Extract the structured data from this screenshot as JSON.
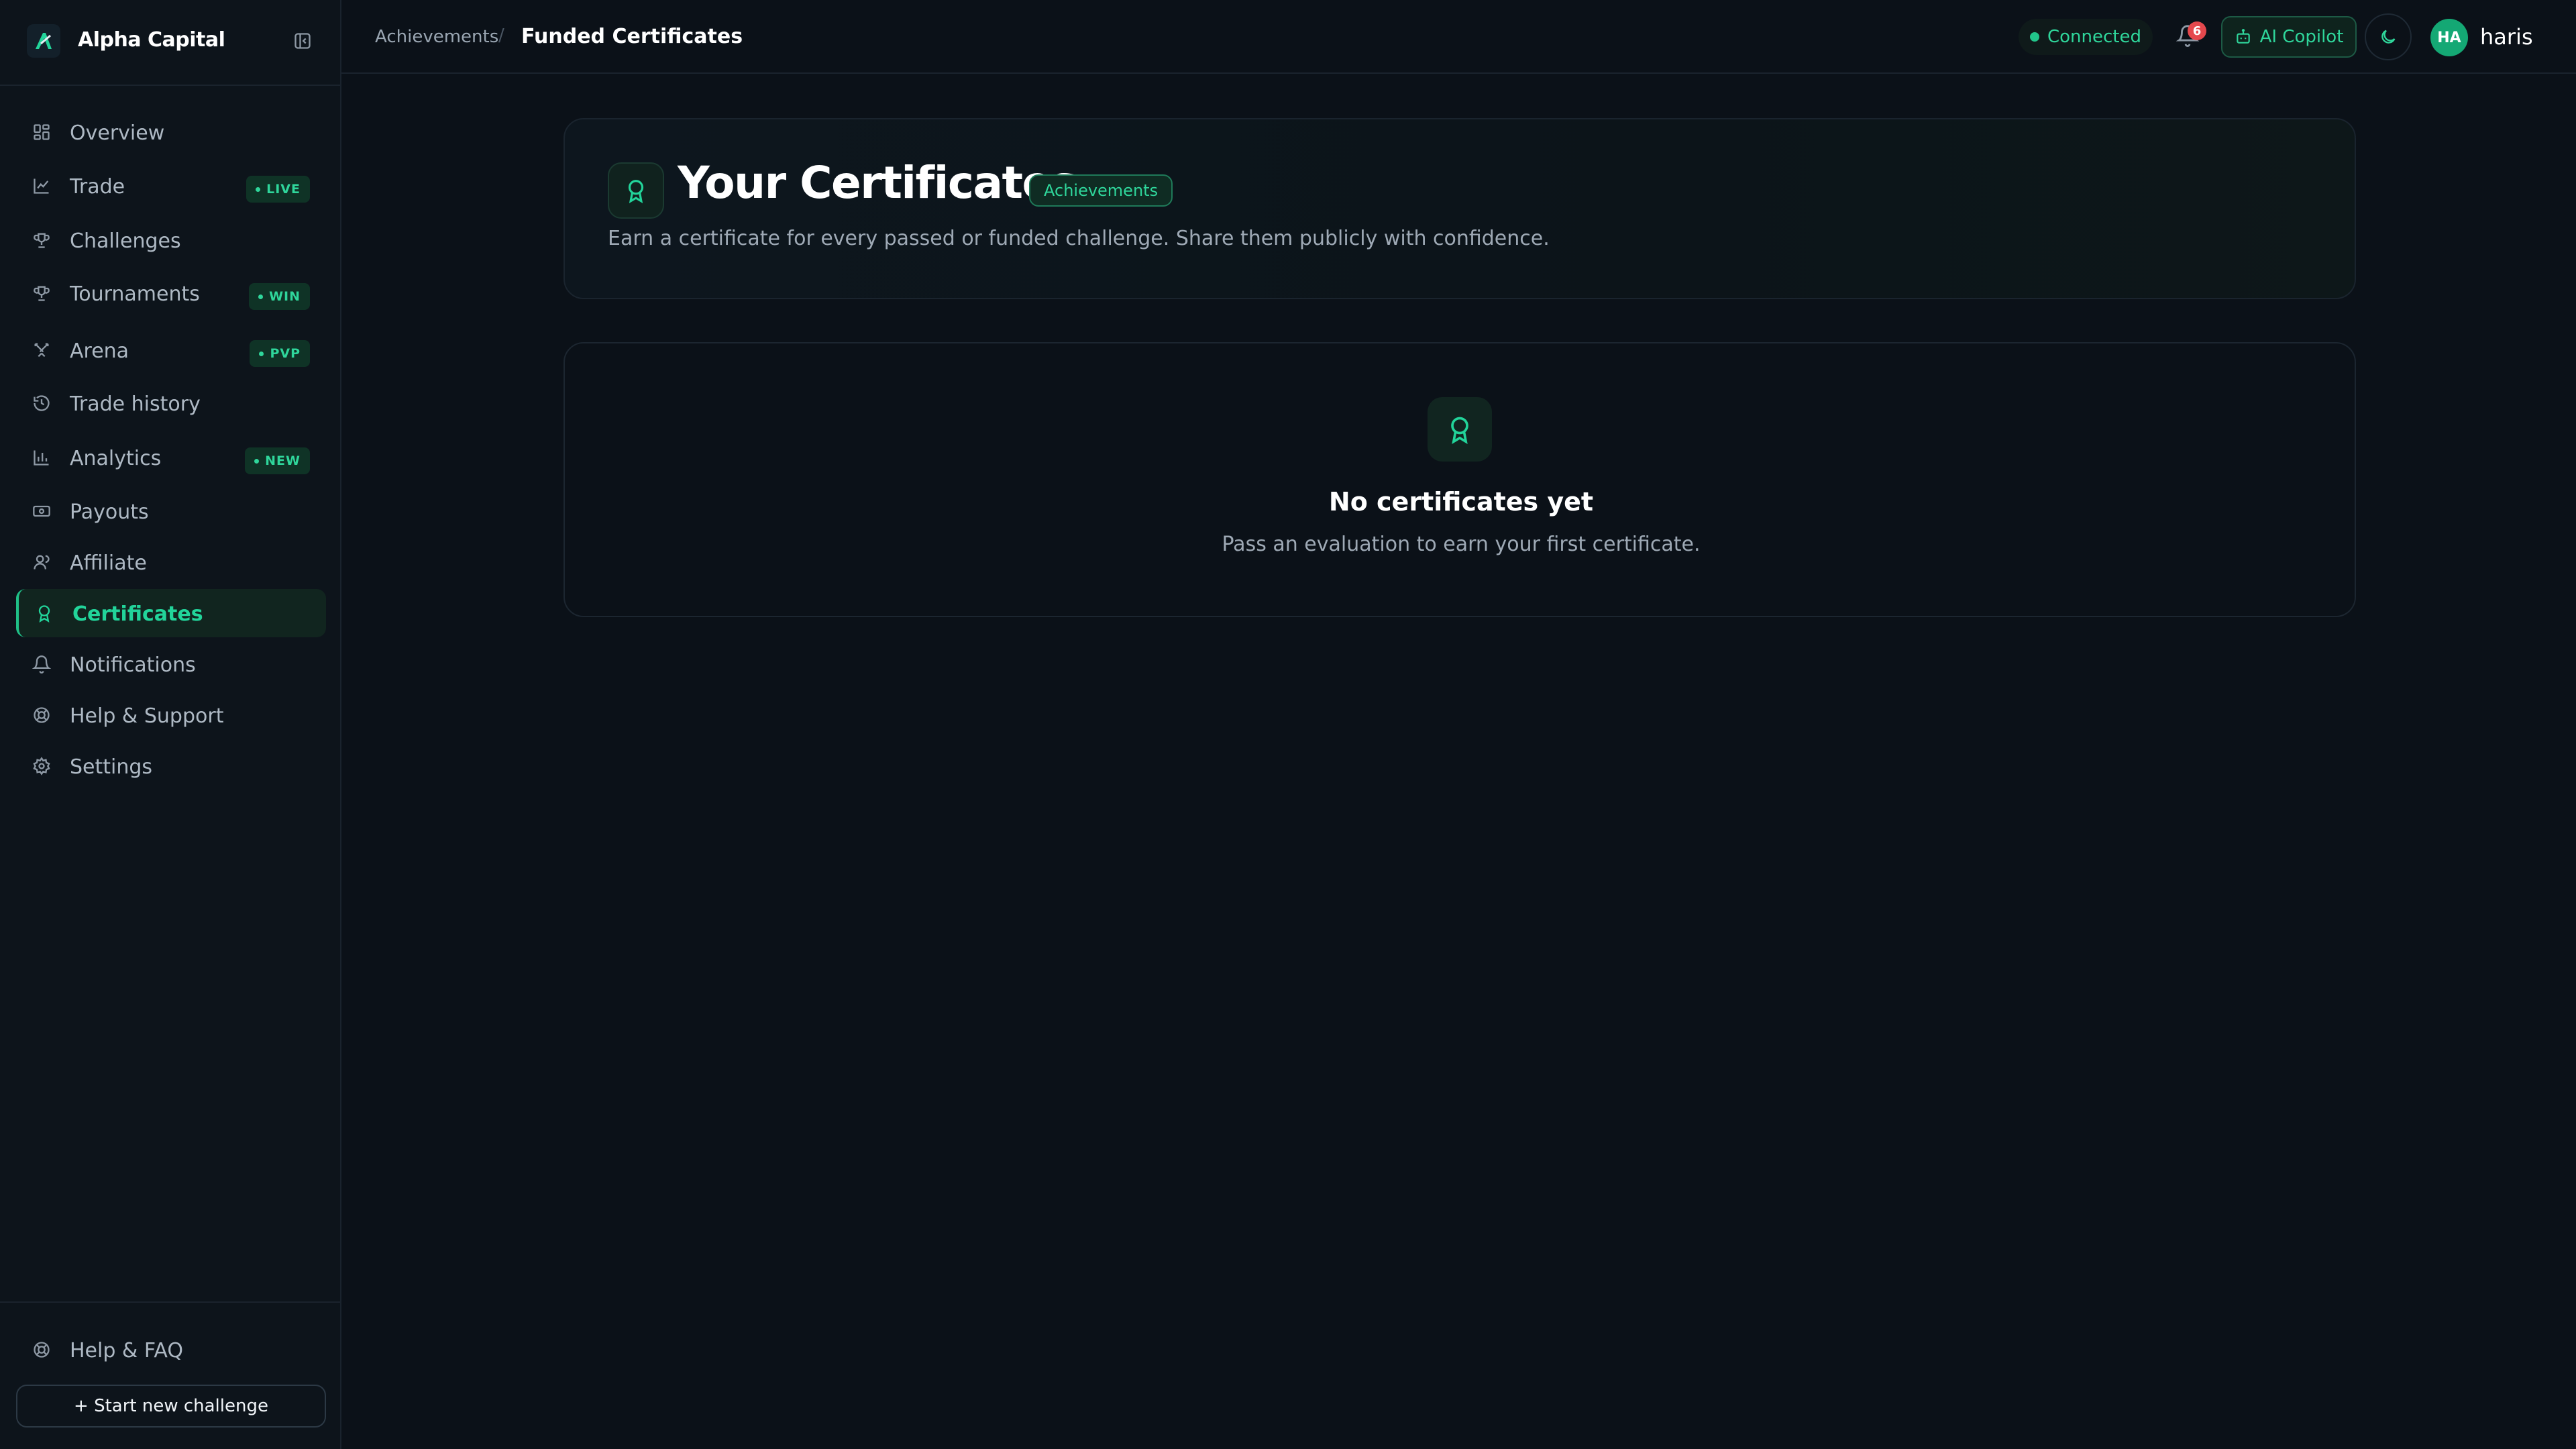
{
  "brand": {
    "name": "Alpha Capital"
  },
  "sidebar": {
    "items": [
      {
        "label": "Overview",
        "icon": "grid-icon"
      },
      {
        "label": "Trade",
        "icon": "chart-icon",
        "badge": "LIVE"
      },
      {
        "label": "Challenges",
        "icon": "trophy-icon"
      },
      {
        "label": "Tournaments",
        "icon": "trophy-icon",
        "badge": "WIN"
      },
      {
        "label": "Arena",
        "icon": "swords-icon",
        "badge": "PVP"
      },
      {
        "label": "Trade history",
        "icon": "history-icon"
      },
      {
        "label": "Analytics",
        "icon": "bar-chart-icon",
        "badge": "NEW"
      },
      {
        "label": "Payouts",
        "icon": "banknote-icon"
      },
      {
        "label": "Affiliate",
        "icon": "user-icon"
      },
      {
        "label": "Certificates",
        "icon": "award-icon",
        "active": true
      },
      {
        "label": "Notifications",
        "icon": "bell-icon"
      },
      {
        "label": "Help & Support",
        "icon": "lifebuoy-icon"
      },
      {
        "label": "Settings",
        "icon": "gear-icon"
      }
    ],
    "bottom": {
      "help_label": "Help & FAQ",
      "start_label": "+ Start new challenge"
    }
  },
  "header": {
    "breadcrumb": [
      "Achievements",
      "Funded Certificates"
    ],
    "status": "Connected",
    "notification_count": "6",
    "copilot_label": "AI Copilot",
    "avatar_initials": "HA",
    "username": "haris"
  },
  "main": {
    "hero": {
      "title": "Your Certificates",
      "tag": "Achievements",
      "subtitle": "Earn a certificate for every passed or funded challenge. Share them publicly with confidence."
    },
    "empty_state": {
      "title": "No certificates yet",
      "subtitle": "Pass an evaluation to earn your first certificate."
    }
  },
  "colors": {
    "background": "#0b1118",
    "sidebar": "#0d141b",
    "accent": "#22d49a",
    "notification": "#e5484d"
  }
}
